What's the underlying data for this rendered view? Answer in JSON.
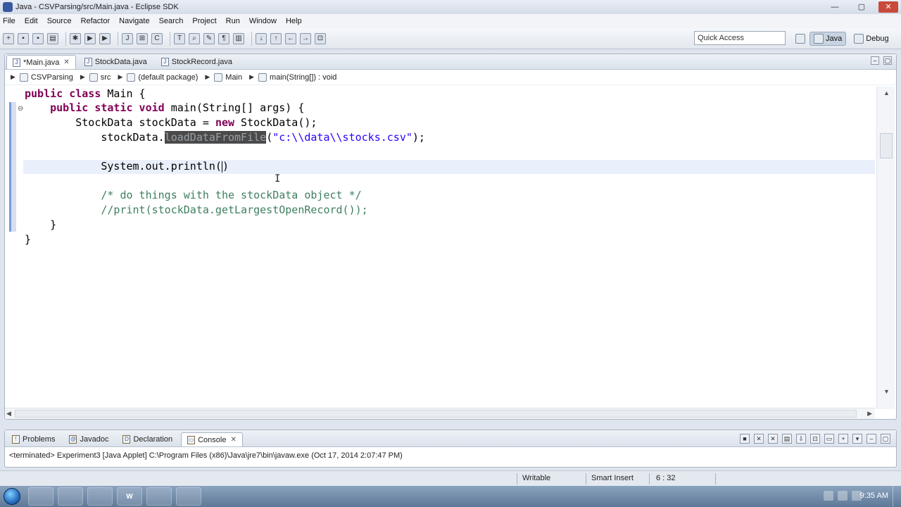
{
  "window": {
    "title": "Java - CSVParsing/src/Main.java - Eclipse SDK",
    "minimize": "—",
    "maximize": "▢",
    "close": "✕"
  },
  "menu": [
    "File",
    "Edit",
    "Source",
    "Refactor",
    "Navigate",
    "Search",
    "Project",
    "Run",
    "Window",
    "Help"
  ],
  "toolbar": {
    "quick_access_placeholder": "Quick Access",
    "perspectives": [
      {
        "label": "Java",
        "active": true
      },
      {
        "label": "Debug",
        "active": false
      }
    ]
  },
  "editor": {
    "tabs": [
      {
        "label": "*Main.java",
        "active": true,
        "closable": true
      },
      {
        "label": "StockData.java",
        "active": false,
        "closable": false
      },
      {
        "label": "StockRecord.java",
        "active": false,
        "closable": false
      }
    ],
    "breadcrumb": [
      "CSVParsing",
      "src",
      "(default package)",
      "Main",
      "main(String[]) : void"
    ],
    "code": {
      "line1_kw": "public class",
      "line1_rest": " Main {",
      "line2_indent": "    ",
      "line2_kw": "public static void",
      "line2_rest": " main(String[] args) {",
      "line3_pre": "        StockData stockData = ",
      "line3_kw": "new",
      "line3_rest": " StockData();",
      "line4_pre": "            stockData.",
      "line4_hl": "loadDataFromFile",
      "line4_mid": "(",
      "line4_str": "\"c:\\\\data\\\\stocks.csv\"",
      "line4_end": ");",
      "line6_pre": "            System.out.println(",
      "line6_end": ")",
      "line8": "            /* do things with the stockData object */",
      "line9": "            //print(stockData.getLargestOpenRecord());",
      "line10": "    }",
      "line11": "}"
    }
  },
  "bottom": {
    "tabs": [
      {
        "label": "Problems",
        "active": false
      },
      {
        "label": "Javadoc",
        "active": false
      },
      {
        "label": "Declaration",
        "active": false
      },
      {
        "label": "Console",
        "active": true
      }
    ],
    "console_status": "<terminated> Experiment3 [Java Applet] C:\\Program Files (x86)\\Java\\jre7\\bin\\javaw.exe (Oct 17, 2014 2:07:47 PM)"
  },
  "status": {
    "writable": "Writable",
    "insert_mode": "Smart Insert",
    "position": "6 : 32"
  },
  "taskbar": {
    "apps": [
      "",
      "",
      "",
      "W",
      "",
      ""
    ],
    "clock": "9:35 AM"
  }
}
